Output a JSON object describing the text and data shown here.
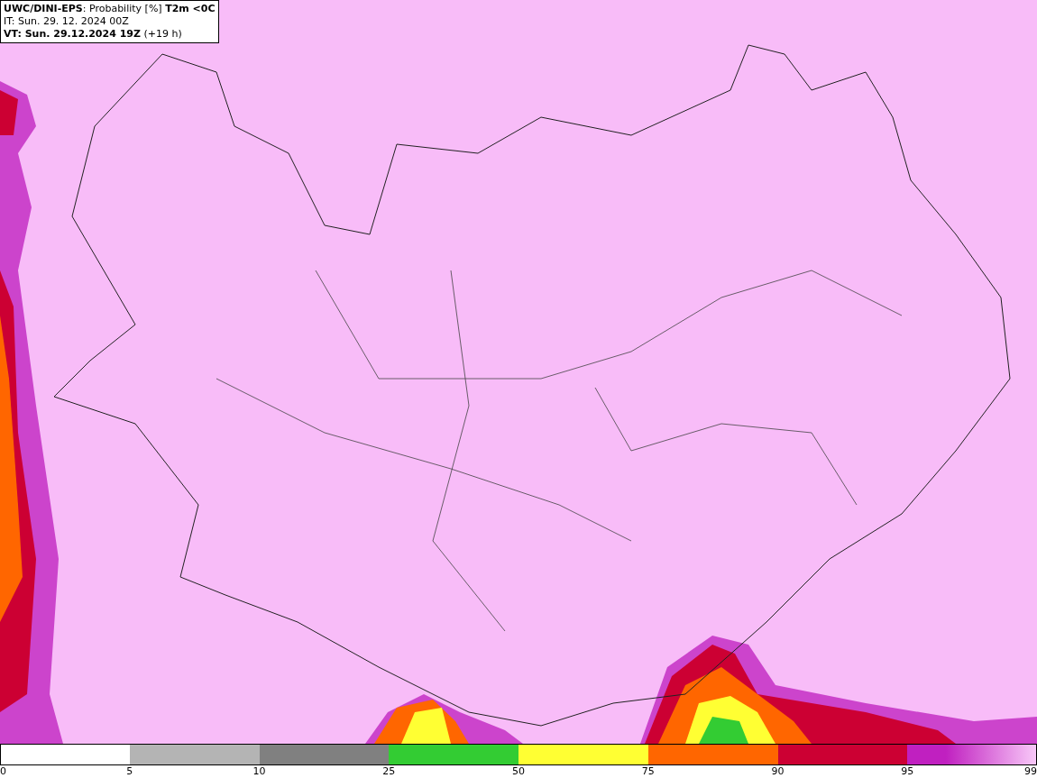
{
  "title_box": {
    "lines": [
      "**UWC/DINI-EPS**: Probability [%] **T2m <0C**",
      "IT: Sun. 29. 12. 2024 00Z",
      "**VT: Sun. 29.12.2024 19Z** (+19 h)"
    ]
  },
  "legend": {
    "segments": [
      {
        "color": "#ffffff",
        "kind": "solid"
      },
      {
        "color": "#b4b4b4",
        "kind": "solid"
      },
      {
        "color": "#808080",
        "kind": "solid"
      },
      {
        "color": "#33cc33",
        "kind": "solid"
      },
      {
        "color": "#ffff33",
        "kind": "solid"
      },
      {
        "color": "#ff6600",
        "kind": "solid"
      },
      {
        "color": "#cc0033",
        "kind": "solid"
      },
      {
        "color": "#c020c0",
        "kind": "gradient"
      }
    ],
    "ticks": [
      "0",
      "5",
      "10",
      "25",
      "50",
      "75",
      "90",
      "95",
      "99"
    ]
  }
}
